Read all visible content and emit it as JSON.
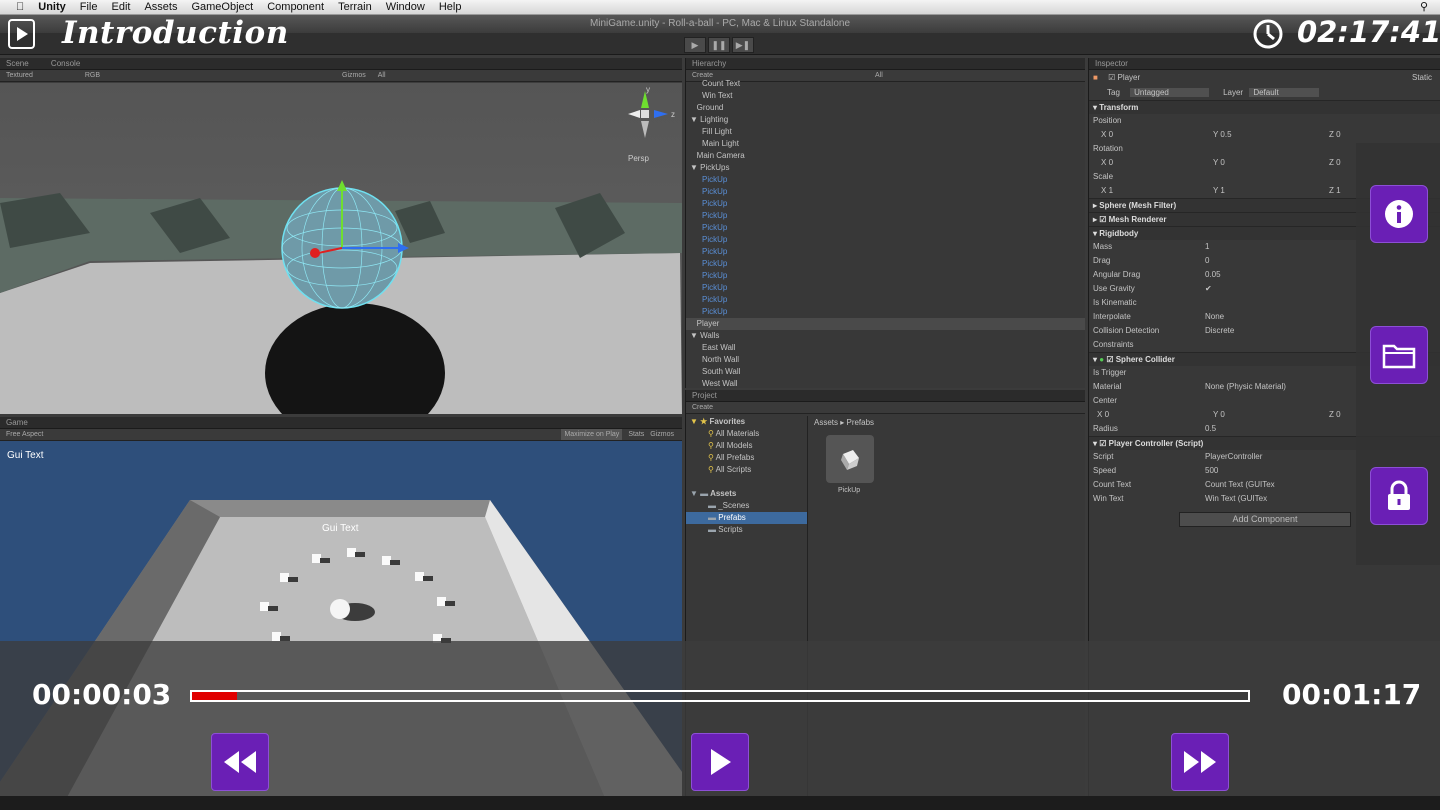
{
  "menubar": {
    "app": "Unity",
    "items": [
      "File",
      "Edit",
      "Assets",
      "GameObject",
      "Component",
      "Terrain",
      "Window",
      "Help"
    ]
  },
  "window_title": "MiniGame.unity - Roll-a-ball - PC, Mac & Linux Standalone",
  "scene_panel": {
    "tabs": [
      "Scene",
      "Console"
    ],
    "shading": "Textured",
    "color_mode": "RGB",
    "gizmos": "Gizmos",
    "search": "All",
    "persp": "Persp"
  },
  "game_panel": {
    "tab": "Game",
    "aspect": "Free Aspect",
    "buttons": [
      "Maximize on Play",
      "Stats",
      "Gizmos"
    ],
    "gui_text_corner": "Gui Text",
    "gui_text_center": "Gui Text"
  },
  "hierarchy": {
    "tab": "Hierarchy",
    "create": "Create",
    "search": "All",
    "rows": [
      {
        "label": "Count Text",
        "indent": 2,
        "style": "normal"
      },
      {
        "label": "Win Text",
        "indent": 2,
        "style": "normal"
      },
      {
        "label": "Ground",
        "indent": 1,
        "style": "normal"
      },
      {
        "label": "Lighting",
        "indent": 1,
        "style": "normal",
        "arrow": "▼"
      },
      {
        "label": "Fill Light",
        "indent": 2,
        "style": "normal"
      },
      {
        "label": "Main Light",
        "indent": 2,
        "style": "normal"
      },
      {
        "label": "Main Camera",
        "indent": 1,
        "style": "normal"
      },
      {
        "label": "PickUps",
        "indent": 1,
        "style": "normal",
        "arrow": "▼"
      },
      {
        "label": "PickUp",
        "indent": 2,
        "style": "blue"
      },
      {
        "label": "PickUp",
        "indent": 2,
        "style": "blue"
      },
      {
        "label": "PickUp",
        "indent": 2,
        "style": "blue"
      },
      {
        "label": "PickUp",
        "indent": 2,
        "style": "blue"
      },
      {
        "label": "PickUp",
        "indent": 2,
        "style": "blue"
      },
      {
        "label": "PickUp",
        "indent": 2,
        "style": "blue"
      },
      {
        "label": "PickUp",
        "indent": 2,
        "style": "blue"
      },
      {
        "label": "PickUp",
        "indent": 2,
        "style": "blue"
      },
      {
        "label": "PickUp",
        "indent": 2,
        "style": "blue"
      },
      {
        "label": "PickUp",
        "indent": 2,
        "style": "blue"
      },
      {
        "label": "PickUp",
        "indent": 2,
        "style": "blue"
      },
      {
        "label": "PickUp",
        "indent": 2,
        "style": "blue"
      },
      {
        "label": "Player",
        "indent": 1,
        "style": "sel"
      },
      {
        "label": "Walls",
        "indent": 1,
        "style": "normal",
        "arrow": "▼"
      },
      {
        "label": "East Wall",
        "indent": 2,
        "style": "normal"
      },
      {
        "label": "North Wall",
        "indent": 2,
        "style": "normal"
      },
      {
        "label": "South Wall",
        "indent": 2,
        "style": "normal"
      },
      {
        "label": "West Wall",
        "indent": 2,
        "style": "normal"
      }
    ]
  },
  "project": {
    "tab": "Project",
    "create": "Create",
    "tree": [
      {
        "label": "Favorites",
        "type": "star-head"
      },
      {
        "label": "All Materials",
        "type": "search"
      },
      {
        "label": "All Models",
        "type": "search"
      },
      {
        "label": "All Prefabs",
        "type": "search"
      },
      {
        "label": "All Scripts",
        "type": "search"
      },
      {
        "label": "",
        "type": "blank"
      },
      {
        "label": "Assets",
        "type": "folder-head"
      },
      {
        "label": "_Scenes",
        "type": "folder"
      },
      {
        "label": "Prefabs",
        "type": "folder-sel"
      },
      {
        "label": "Scripts",
        "type": "folder"
      }
    ],
    "breadcrumb": [
      "Assets",
      "Prefabs"
    ],
    "asset_name": "PickUp"
  },
  "inspector": {
    "tab": "Inspector",
    "object_name": "Player",
    "static_label": "Static",
    "tag_label": "Tag",
    "tag_value": "Untagged",
    "layer_label": "Layer",
    "layer_value": "Default",
    "transform": {
      "title": "Transform",
      "position": {
        "label": "Position",
        "x": "0",
        "y": "0.5",
        "z": "0"
      },
      "rotation": {
        "label": "Rotation",
        "x": "0",
        "y": "0",
        "z": "0"
      },
      "scale": {
        "label": "Scale",
        "x": "1",
        "y": "1",
        "z": "1"
      }
    },
    "mesh_filter": "Sphere (Mesh Filter)",
    "mesh_renderer": "Mesh Renderer",
    "rigidbody": {
      "title": "Rigidbody",
      "rows": [
        {
          "label": "Mass",
          "value": "1"
        },
        {
          "label": "Drag",
          "value": "0"
        },
        {
          "label": "Angular Drag",
          "value": "0.05"
        },
        {
          "label": "Use Gravity",
          "value": "✔"
        },
        {
          "label": "Is Kinematic",
          "value": ""
        },
        {
          "label": "Interpolate",
          "value": "None"
        },
        {
          "label": "Collision Detection",
          "value": "Discrete"
        },
        {
          "label": "Constraints",
          "value": ""
        }
      ]
    },
    "sphere_collider": {
      "title": "Sphere Collider",
      "rows": [
        {
          "label": "Is Trigger",
          "value": ""
        },
        {
          "label": "Material",
          "value": "None (Physic Material)"
        },
        {
          "label": "Center",
          "value": ""
        },
        {
          "label": "",
          "value": ""
        },
        {
          "label": "Radius",
          "value": "0.5"
        }
      ],
      "center": {
        "x": "0",
        "y": "0",
        "z": "0"
      }
    },
    "player_controller": {
      "title": "Player Controller (Script)",
      "rows": [
        {
          "label": "Script",
          "value": "PlayerController"
        },
        {
          "label": "Speed",
          "value": "500"
        },
        {
          "label": "Count Text",
          "value": "Count Text (GUITex"
        },
        {
          "label": "Win Text",
          "value": "Win Text (GUITex"
        }
      ]
    },
    "add_component": "Add Component"
  },
  "player": {
    "title": "Introduction",
    "clock": "02:17:41",
    "current_time": "00:00:03",
    "total_time": "00:01:17",
    "progress_fraction": 0.043,
    "accent_color": "#6a1fb5",
    "progress_color": "#e00000",
    "buttons": [
      "rewind-icon",
      "play-icon",
      "fast-forward-icon"
    ],
    "side_buttons": [
      "info-icon",
      "folder-icon",
      "lock-icon"
    ]
  }
}
